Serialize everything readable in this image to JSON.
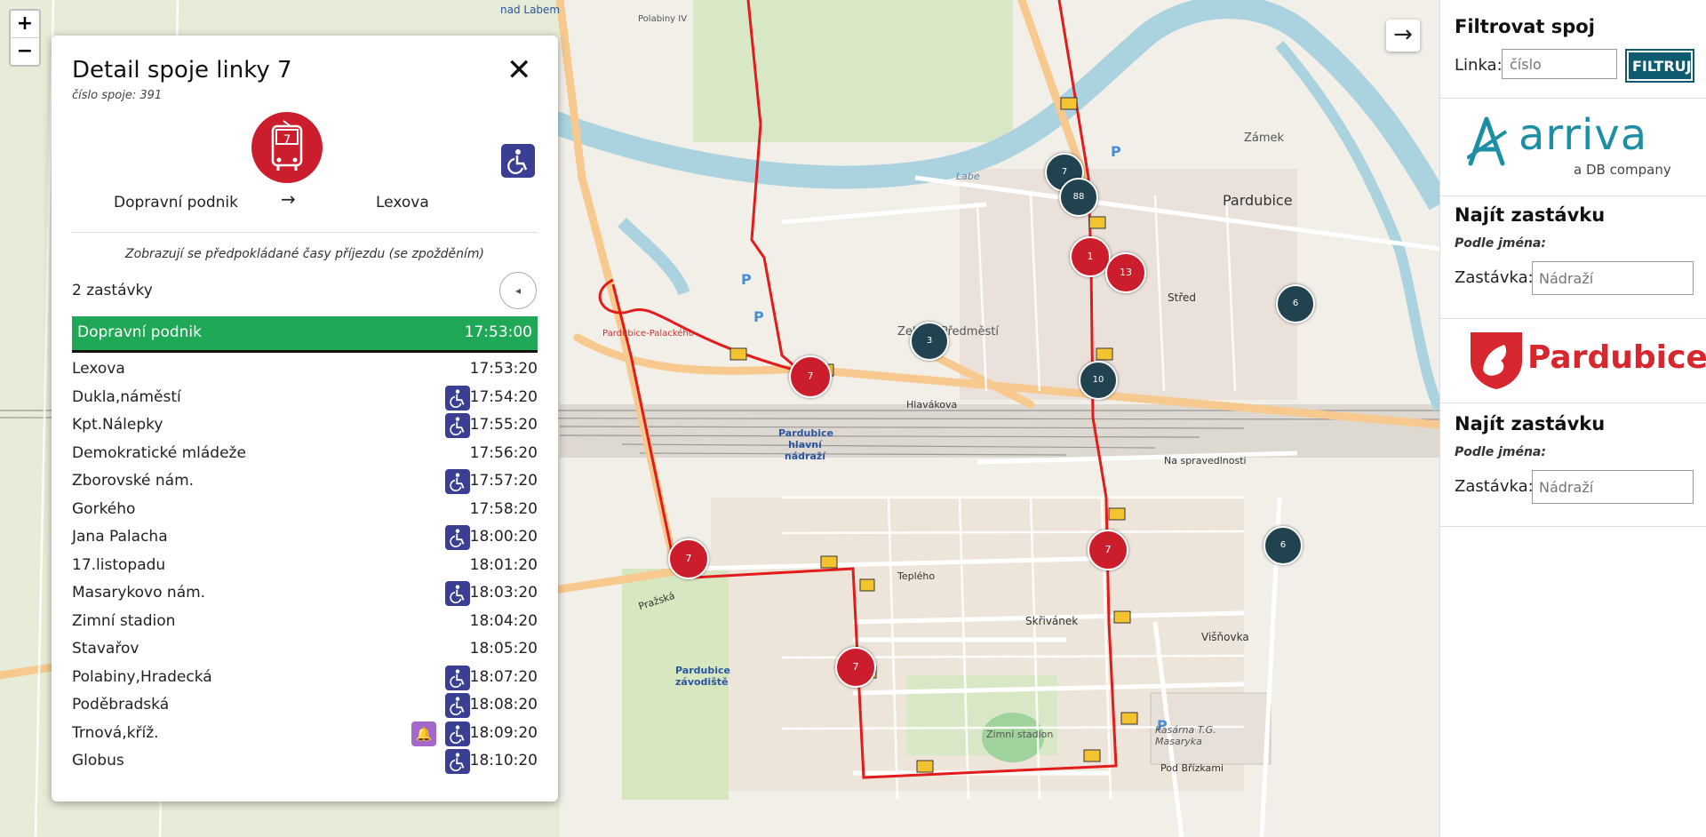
{
  "map": {
    "zoom_in": "+",
    "zoom_out": "−",
    "toggle_arrow": "→",
    "labels": [
      {
        "text": "nad Labem",
        "cls": "place"
      },
      {
        "text": "Pardubice",
        "cls": "city"
      },
      {
        "text": "Zámek",
        "cls": "place"
      },
      {
        "text": "Pardubice hlavní nádraží",
        "cls": "station"
      },
      {
        "text": "Hlavákova",
        "cls": "road"
      },
      {
        "text": "Teplého",
        "cls": "road"
      },
      {
        "text": "Pražská",
        "cls": "road"
      },
      {
        "text": "Zimní stadion",
        "cls": "place"
      },
      {
        "text": "Kasárna T.G. Masaryka",
        "cls": "place"
      },
      {
        "text": "Pardubice závodiště",
        "cls": "station"
      },
      {
        "text": "Labe",
        "cls": "water"
      },
      {
        "text": "Střed",
        "cls": "place"
      },
      {
        "text": "Zelené Předměstí",
        "cls": "place"
      },
      {
        "text": "Višňovka",
        "cls": "place"
      },
      {
        "text": "Skřivánek",
        "cls": "place"
      },
      {
        "text": "Na spravedlnosti",
        "cls": "place"
      },
      {
        "text": "Pod Břízkami",
        "cls": "road"
      },
      {
        "text": "Polabiny IV",
        "cls": "place"
      },
      {
        "text": "Pardubice-Palackého",
        "cls": "station"
      }
    ],
    "bus_markers": [
      {
        "line": "7",
        "type": "red"
      },
      {
        "line": "7",
        "type": "red"
      },
      {
        "line": "7",
        "type": "red"
      },
      {
        "line": "1",
        "type": "red"
      },
      {
        "line": "13",
        "type": "red"
      },
      {
        "line": "7",
        "type": "red"
      },
      {
        "line": "7",
        "type": "dark"
      },
      {
        "line": "88",
        "type": "dark"
      },
      {
        "line": "3",
        "type": "dark"
      },
      {
        "line": "10",
        "type": "dark"
      },
      {
        "line": "6",
        "type": "dark"
      },
      {
        "line": "6",
        "type": "dark"
      }
    ]
  },
  "detail": {
    "title": "Detail spoje linky 7",
    "connection_number": "číslo spoje: 391",
    "line_number": "7",
    "from": "Dopravní podnik",
    "arrow": "→",
    "to": "Lexova",
    "close": "✕",
    "note": "Zobrazují se předpokládané časy příjezdu (se zpožděním)",
    "stop_count": "2 zastávky",
    "collapse_icon": "◂",
    "current_stop": {
      "name": "Dopravní podnik",
      "time": "17:53:00"
    },
    "stops": [
      {
        "name": "Lexova",
        "time": "17:53:20",
        "wheelchair": false,
        "bell": false
      },
      {
        "name": "Dukla,náměstí",
        "time": "17:54:20",
        "wheelchair": true,
        "bell": false
      },
      {
        "name": "Kpt.Nálepky",
        "time": "17:55:20",
        "wheelchair": true,
        "bell": false
      },
      {
        "name": "Demokratické mládeže",
        "time": "17:56:20",
        "wheelchair": false,
        "bell": false
      },
      {
        "name": "Zborovské nám.",
        "time": "17:57:20",
        "wheelchair": true,
        "bell": false
      },
      {
        "name": "Gorkého",
        "time": "17:58:20",
        "wheelchair": false,
        "bell": false
      },
      {
        "name": "Jana Palacha",
        "time": "18:00:20",
        "wheelchair": true,
        "bell": false
      },
      {
        "name": "17.listopadu",
        "time": "18:01:20",
        "wheelchair": false,
        "bell": false
      },
      {
        "name": "Masarykovo nám.",
        "time": "18:03:20",
        "wheelchair": true,
        "bell": false
      },
      {
        "name": "Zimní stadion",
        "time": "18:04:20",
        "wheelchair": false,
        "bell": false
      },
      {
        "name": "Stavařov",
        "time": "18:05:20",
        "wheelchair": false,
        "bell": false
      },
      {
        "name": "Polabiny,Hradecká",
        "time": "18:07:20",
        "wheelchair": true,
        "bell": false
      },
      {
        "name": "Poděbradská",
        "time": "18:08:20",
        "wheelchair": true,
        "bell": false
      },
      {
        "name": "Trnová,kříž.",
        "time": "18:09:20",
        "wheelchair": true,
        "bell": true
      },
      {
        "name": "Globus",
        "time": "18:10:20",
        "wheelchair": true,
        "bell": false
      }
    ]
  },
  "sidebar": {
    "filter_title": "Filtrovat spoj",
    "linka_label": "Linka:",
    "linka_placeholder": "číslo",
    "filter_button": "FILTRUJ",
    "arriva": {
      "name": "arriva",
      "tagline": "a DB company",
      "color": "#1c8fa4"
    },
    "pardubice": {
      "name": "Pardubice",
      "color": "#d8262e"
    },
    "find_stop_1": {
      "title": "Najít zastávku",
      "by_name": "Podle jména:",
      "label": "Zastávka:",
      "placeholder": "Nádraží"
    },
    "find_stop_2": {
      "title": "Najít zastávku",
      "by_name": "Podle jména:",
      "label": "Zastávka:",
      "placeholder": "Nádraží"
    }
  },
  "colors": {
    "route_red": "#e21b1b",
    "bus_red": "#cc1d2d",
    "bus_dark": "#21434f",
    "current_stop_green": "#1fa855",
    "wheelchair_blue": "#3b3f94",
    "bell_purple": "#a368c9",
    "river_blue": "#aad3df",
    "road_orange": "#f7c98f"
  }
}
